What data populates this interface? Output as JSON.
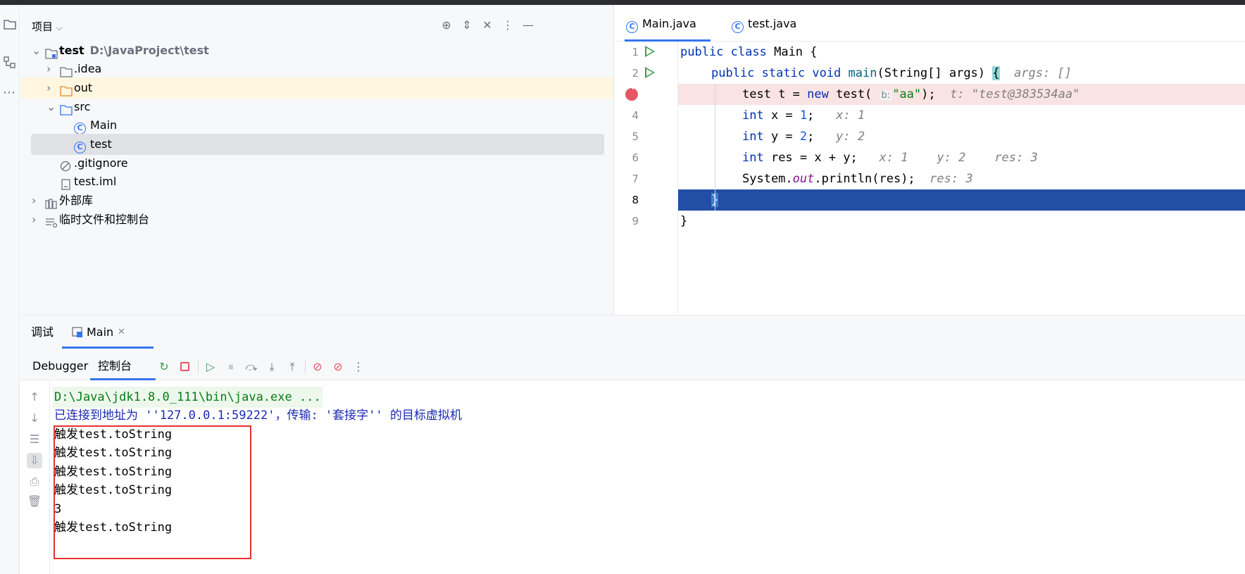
{
  "project_panel": {
    "title": "项目",
    "tree": [
      {
        "label": "test",
        "path": "D:\\JavaProject\\test"
      },
      {
        "label": ".idea"
      },
      {
        "label": "out"
      },
      {
        "label": "src"
      },
      {
        "label": "Main"
      },
      {
        "label": "test"
      },
      {
        "label": ".gitignore"
      },
      {
        "label": "test.iml"
      },
      {
        "label": "外部库"
      },
      {
        "label": "临时文件和控制台"
      }
    ]
  },
  "editor": {
    "tabs": [
      {
        "label": "Main.java"
      },
      {
        "label": "test.java"
      }
    ],
    "line_numbers": [
      "1",
      "2",
      "3",
      "4",
      "5",
      "6",
      "7",
      "8",
      "9"
    ],
    "code": {
      "l1": {
        "kw1": "public",
        "kw2": "class",
        "rest": " Main {"
      },
      "l2": {
        "kw1": "public",
        "kw2": "static",
        "kw3": "void",
        "fn": "main",
        "rest": "(String[] args) ",
        "brace": "{",
        "hint": "args: []"
      },
      "l3": {
        "pre": "test ",
        "var": "t",
        "mid": " = ",
        "kw": "new",
        "call": " test(",
        "inlay": "b:",
        "str": "\"aa\"",
        "end": ");",
        "hint": "t: \"test@383534aa\""
      },
      "l4": {
        "kw": "int",
        "rest": " x = ",
        "num": "1",
        "end": ";",
        "hint": "x: 1"
      },
      "l5": {
        "kw": "int",
        "rest": " y = ",
        "num": "2",
        "end": ";",
        "hint": "y: 2"
      },
      "l6": {
        "kw": "int",
        "rest": " res = x + y;",
        "hint1": "x: 1",
        "hint2": "y: 2",
        "hint3": "res: 3"
      },
      "l7": {
        "pre": "System.",
        "field": "out",
        "rest": ".println(res);",
        "hint": "res: 3"
      },
      "l8": {
        "brace": "}"
      },
      "l9": {
        "brace": "}"
      }
    }
  },
  "debug_panel": {
    "tab_debug": "调试",
    "tab_main": "Main",
    "toolbar": {
      "debugger": "Debugger",
      "console": "控制台"
    },
    "console_lines": [
      "D:\\Java\\jdk1.8.0_111\\bin\\java.exe ...",
      "已连接到地址为 ''127.0.0.1:59222'，传输: '套接字'' 的目标虚拟机",
      "触发test.toString",
      "触发test.toString",
      "触发test.toString",
      "触发test.toString",
      "3",
      "触发test.toString"
    ]
  },
  "colors": {
    "accent": "#3574f0",
    "run_green": "#3e9c55",
    "breakpoint_red": "#e55765",
    "current_line": "#214fa6",
    "annotation_red": "#e5322d"
  }
}
